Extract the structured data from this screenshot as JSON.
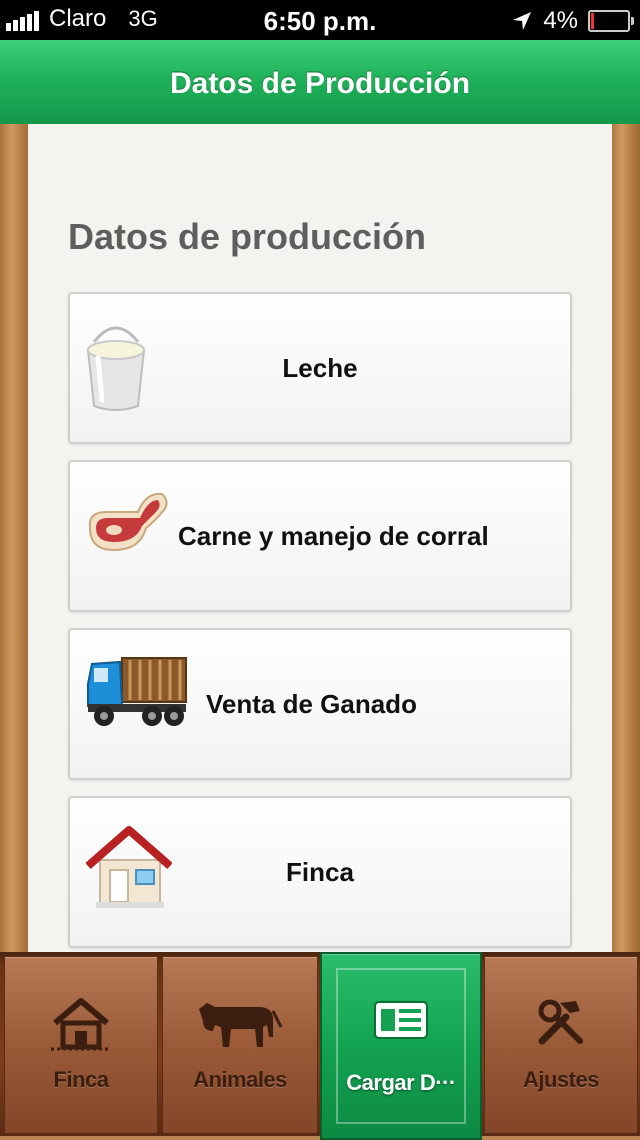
{
  "status_bar": {
    "carrier": "Claro",
    "network": "3G",
    "time": "6:50 p.m.",
    "battery": "4%",
    "icons": [
      "signal-bars-icon",
      "location-arrow-icon",
      "battery-icon"
    ]
  },
  "navbar": {
    "title": "Datos de Producción"
  },
  "main": {
    "section_title": "Datos de producción",
    "items": [
      {
        "label": "Leche",
        "icon": "milk-bucket-icon"
      },
      {
        "label": "Carne y manejo de corral",
        "icon": "meat-steak-icon"
      },
      {
        "label": "Venta de Ganado",
        "icon": "cattle-truck-icon"
      },
      {
        "label": "Finca",
        "icon": "farm-house-icon"
      }
    ]
  },
  "tabbar": {
    "tabs": [
      {
        "label": "Finca",
        "icon": "barn-icon",
        "active": false
      },
      {
        "label": "Animales",
        "icon": "cow-icon",
        "active": false
      },
      {
        "label": "Cargar D···",
        "icon": "data-card-icon",
        "active": true
      },
      {
        "label": "Ajustes",
        "icon": "tools-icon",
        "active": false
      }
    ]
  },
  "colors": {
    "nav_green": "#20b25a",
    "tab_brown": "#9a5a38",
    "active_tab_green": "#13a251",
    "panel_bg": "#f4f3f0",
    "title_gray": "#5e5e5e"
  }
}
